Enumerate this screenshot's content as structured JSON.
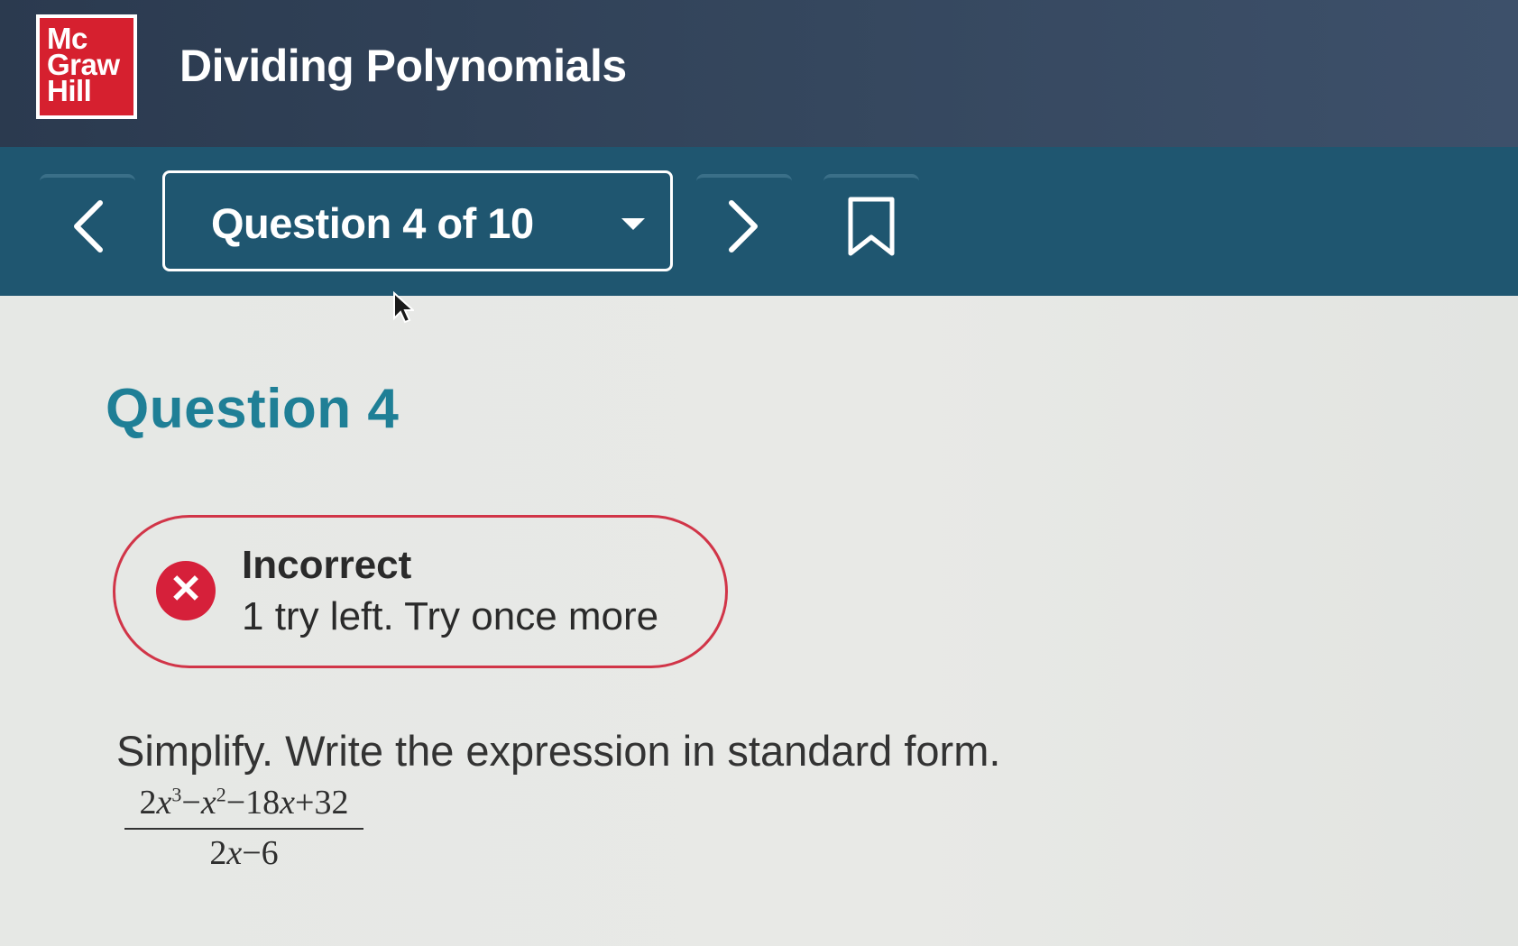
{
  "brand": {
    "logo_lines": [
      "Mc",
      "Graw",
      "Hill"
    ]
  },
  "header": {
    "title": "Dividing Polynomials"
  },
  "nav": {
    "question_selector": "Question 4 of 10",
    "icons": [
      "chevron-left-icon",
      "chevron-right-icon",
      "bookmark-icon",
      "caret-down-icon"
    ]
  },
  "question": {
    "heading": "Question 4",
    "feedback": {
      "status": "Incorrect",
      "message": "1 try left. Try once more"
    },
    "prompt": "Simplify. Write the expression in standard form.",
    "expression": {
      "numerator": {
        "t1_coef": "2",
        "t1_var": "x",
        "t1_exp": "3",
        "op1": "−",
        "t2_var": "x",
        "t2_exp": "2",
        "op2": "−18",
        "t3_var": "x",
        "op3": "+32"
      },
      "denominator": {
        "coef": "2",
        "var": "x",
        "rest": "−6"
      }
    }
  },
  "colors": {
    "topbar": "#2f3e54",
    "navbar": "#1f5670",
    "heading": "#1f7f96",
    "error": "#d6203a",
    "logo": "#d6202f"
  }
}
